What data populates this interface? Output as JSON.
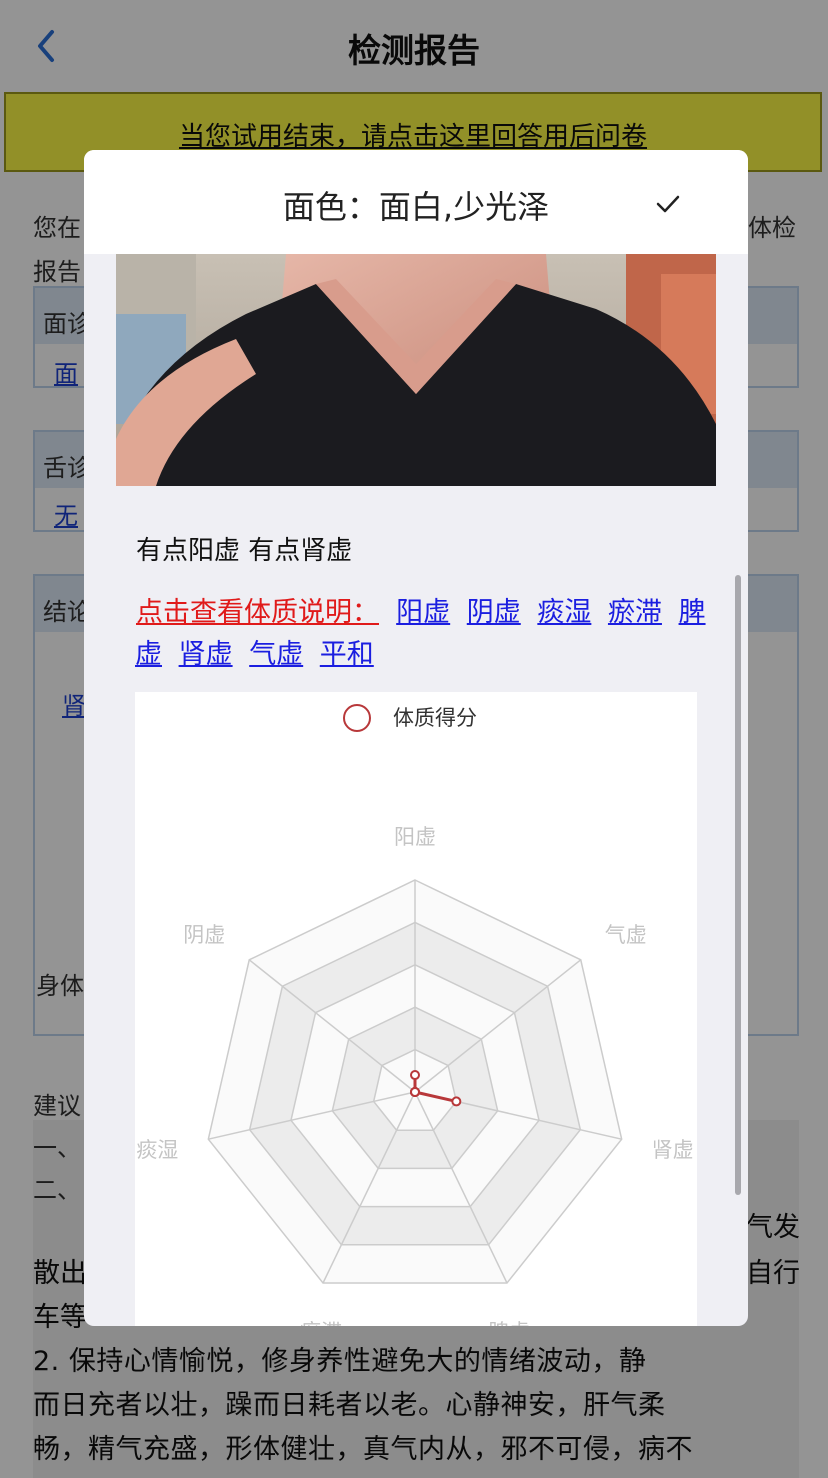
{
  "nav": {
    "title": "检测报告"
  },
  "survey": {
    "link_text": "当您试用结束，请点击这里回答用后问卷"
  },
  "background": {
    "intro_left": "您在",
    "intro_right": "体检",
    "intro_line2": "报告",
    "face_section_label": "面诊",
    "face_link": "面",
    "tongue_section_label": "舌诊",
    "tongue_link": "无",
    "conclusion_label": "结论",
    "conclusion_link": "肾",
    "body_label": "身体",
    "advice_label": "建议",
    "advice_item1": "一、",
    "advice_item2": "二、",
    "para_right1": "气发",
    "para_line1_left": "散出",
    "para_line1_right": "自行",
    "para_line2_left": "车等",
    "para_line3": "2. 保持心情愉悦，修身养性避免大的情绪波动，静",
    "para_line4": "而日充者以壮，躁而日耗者以老。心静神安，肝气柔",
    "para_line5": "畅，精气充盛，形体健壮，真气内从，邪不可侵，病不"
  },
  "modal": {
    "title": "面色：面白,少光泽",
    "confirm_icon": "check-icon",
    "result_text": "有点阳虚 有点肾虚",
    "constitution_intro": "点击查看体质说明：",
    "constitution_links": [
      "阳虚",
      "阴虚",
      "痰湿",
      "瘀滞",
      "脾",
      "虚",
      "肾虚",
      "气虚",
      "平和"
    ]
  },
  "colors": {
    "accent_blue": "#1b1ee0",
    "intro_red": "#e01a1a",
    "series_red": "#b8383a",
    "banner_yellow": "#fbf845"
  },
  "chart_data": {
    "type": "radar",
    "legend": [
      "体质得分"
    ],
    "indicators": [
      "阳虚",
      "气虚",
      "肾虚",
      "脾虚",
      "瘀滞",
      "痰湿",
      "阴虚"
    ],
    "series": [
      {
        "name": "体质得分",
        "values": [
          8,
          0,
          20,
          0,
          0,
          0,
          0
        ]
      }
    ],
    "max": 100,
    "rings": 5,
    "split_area": true
  }
}
